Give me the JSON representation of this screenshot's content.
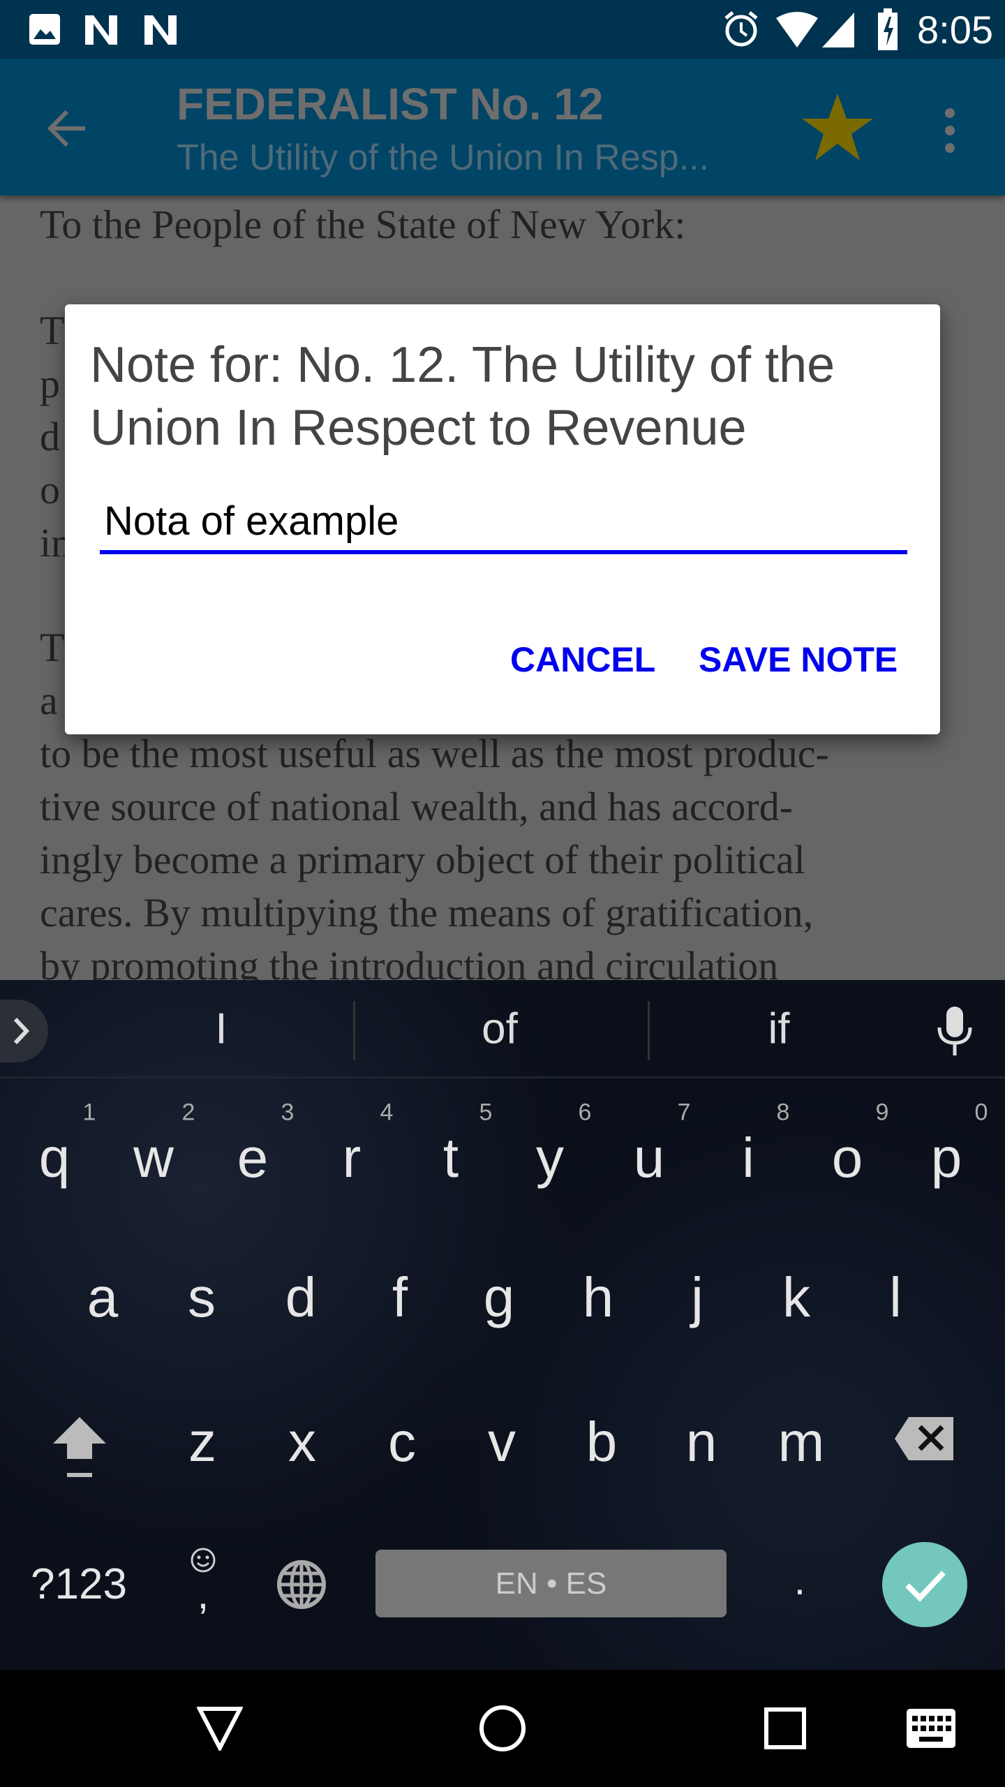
{
  "status_bar": {
    "time": "8:05",
    "left_icons": [
      "image-icon",
      "n-icon",
      "n-icon"
    ],
    "right_icons": [
      "alarm-icon",
      "wifi-icon",
      "signal-icon",
      "battery-charging-icon"
    ]
  },
  "app_bar": {
    "title": "FEDERALIST No. 12",
    "subtitle": "The Utility of the Union In Resp...",
    "icons": [
      "back-arrow-icon",
      "star-icon",
      "more-vert-icon"
    ],
    "star_color": "#7a6a00"
  },
  "content": {
    "greeting": "To the People of the State of New York:",
    "partial_lines": [
      "T",
      "p",
      "d",
      "o",
      "in",
      "T",
      "a"
    ],
    "lines": [
      "to be the most useful as well as the most produc-",
      "tive source of national wealth, and has accord-",
      "ingly become a primary object of their political",
      "cares. By multipying the means of gratification,",
      "by promoting the introduction and circulation"
    ]
  },
  "dialog": {
    "title": "Note for: No. 12. The Utility of the Union In Respect to Revenue",
    "input_value": "Nota of example",
    "cancel": "CANCEL",
    "save": "SAVE NOTE",
    "accent": "#0000ee"
  },
  "keyboard": {
    "suggestions": [
      "I",
      "of",
      "if"
    ],
    "numbers": [
      "1",
      "2",
      "3",
      "4",
      "5",
      "6",
      "7",
      "8",
      "9",
      "0"
    ],
    "row1": [
      "q",
      "w",
      "e",
      "r",
      "t",
      "y",
      "u",
      "i",
      "o",
      "p"
    ],
    "row2": [
      "a",
      "s",
      "d",
      "f",
      "g",
      "h",
      "j",
      "k",
      "l"
    ],
    "row3": [
      "z",
      "x",
      "c",
      "v",
      "b",
      "n",
      "m"
    ],
    "symbols": "?123",
    "comma": ",",
    "space": "EN • ES",
    "period": ".",
    "enter_color": "#73c7bc"
  },
  "nav_bar": {
    "icons": [
      "back-triangle-icon",
      "home-circle-icon",
      "recents-square-icon",
      "keyboard-icon"
    ]
  }
}
